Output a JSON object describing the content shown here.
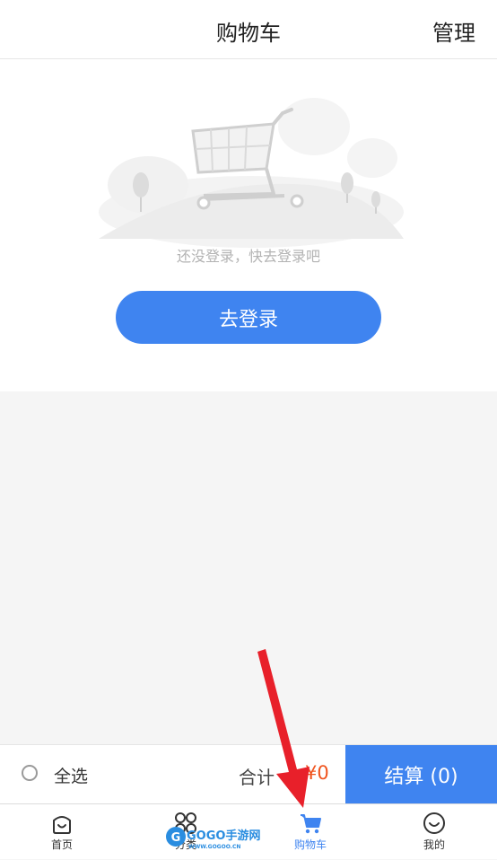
{
  "header": {
    "title": "购物车",
    "manage_label": "管理"
  },
  "empty_state": {
    "message": "还没登录，快去登录吧",
    "login_button": "去登录"
  },
  "checkout": {
    "select_all_label": "全选",
    "total_label": "合计",
    "total_amount": "¥0",
    "checkout_button": "结算 (0)"
  },
  "tabbar": {
    "items": [
      {
        "label": "首页",
        "icon": "home-icon"
      },
      {
        "label": "分类",
        "icon": "category-icon"
      },
      {
        "label": "购物车",
        "icon": "cart-icon",
        "active": true
      },
      {
        "label": "我的",
        "icon": "profile-icon"
      }
    ]
  },
  "watermark": {
    "brand": "GOGO手游网",
    "url": "WWW.GOGOO.CN"
  },
  "colors": {
    "accent": "#3f84f0",
    "price": "#f0541e",
    "arrow": "#e8202a"
  }
}
